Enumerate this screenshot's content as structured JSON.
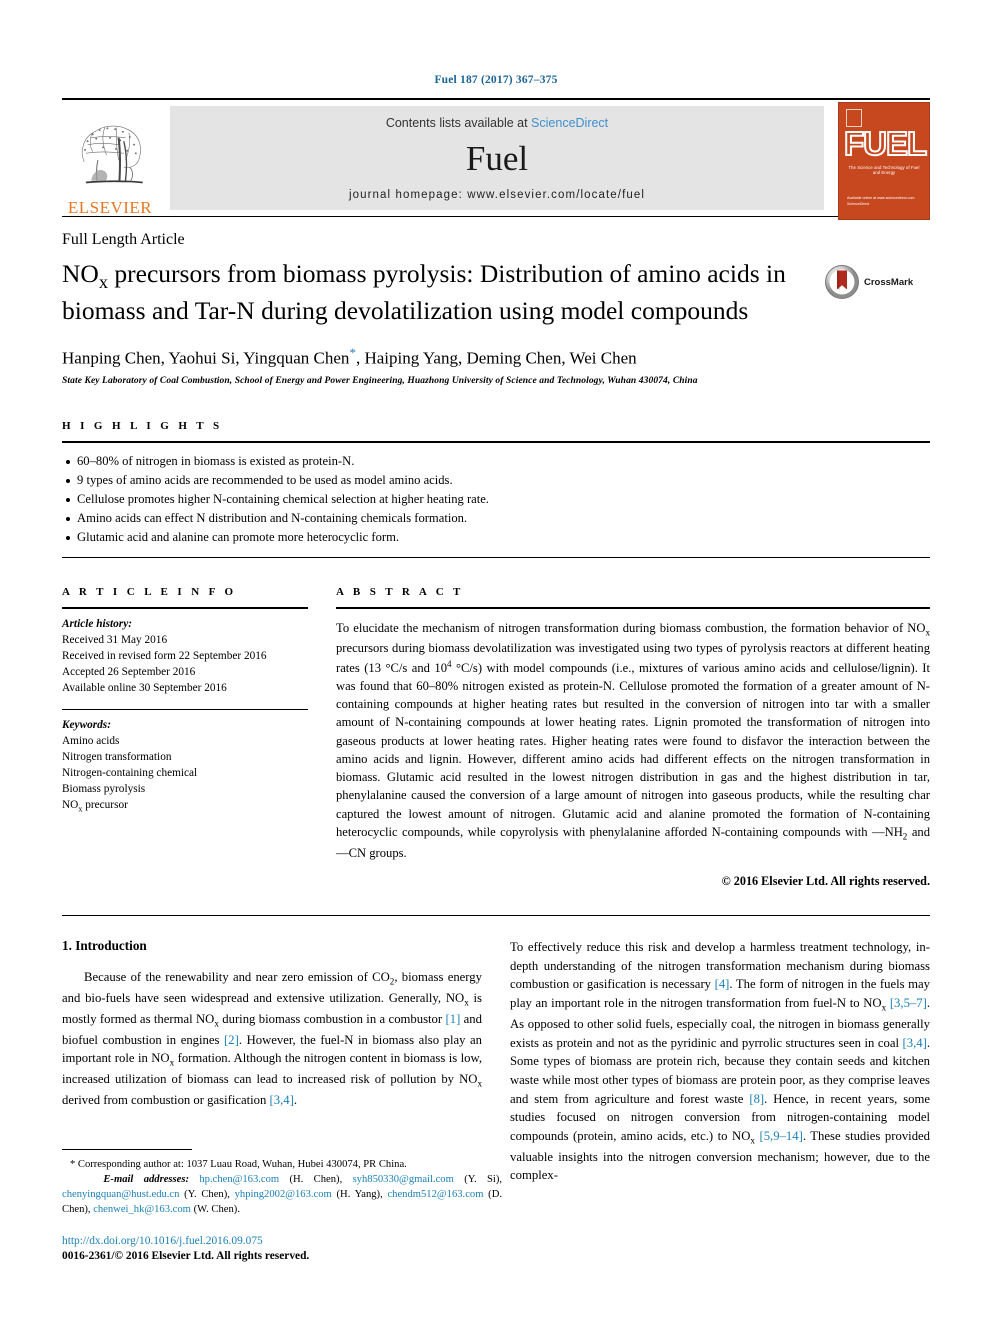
{
  "running_head": "Fuel 187 (2017) 367–375",
  "masthead": {
    "publisher": "ELSEVIER",
    "contents_prefix": "Contents lists available at ",
    "contents_link": "ScienceDirect",
    "journal_title": "Fuel",
    "homepage": "journal homepage: www.elsevier.com/locate/fuel",
    "cover": {
      "wordmark": "FUEL",
      "subtitle": "The Science and Technology of Fuel and Energy",
      "footer": "Available online at www.sciencedirect.com\nScienceDirect"
    }
  },
  "article": {
    "type": "Full Length Article",
    "title": "NOx precursors from biomass pyrolysis: Distribution of amino acids in biomass and Tar-N during devolatilization using model compounds",
    "authors": "Hanping Chen, Yaohui Si, Yingquan Chen",
    "authors_tail": ", Haiping Yang, Deming Chen, Wei Chen",
    "corresponding_marker": "*",
    "affiliation": "State Key Laboratory of Coal Combustion, School of Energy and Power Engineering, Huazhong University of Science and Technology, Wuhan 430074, China",
    "crossmark_label": "CrossMark"
  },
  "highlights": {
    "label": "H I G H L I G H T S",
    "items": [
      "60–80% of nitrogen in biomass is existed as protein-N.",
      "9 types of amino acids are recommended to be used as model amino acids.",
      "Cellulose promotes higher N-containing chemical selection at higher heating rate.",
      "Amino acids can effect N distribution and N-containing chemicals formation.",
      "Glutamic acid and alanine can promote more heterocyclic form."
    ]
  },
  "article_info": {
    "label": "A R T I C L E  I N F O",
    "history_head": "Article history:",
    "history": [
      "Received 31 May 2016",
      "Received in revised form 22 September 2016",
      "Accepted 26 September 2016",
      "Available online 30 September 2016"
    ],
    "keywords_head": "Keywords:",
    "keywords": [
      "Amino acids",
      "Nitrogen transformation",
      "Nitrogen-containing chemical",
      "Biomass pyrolysis",
      "NOx precursor"
    ]
  },
  "abstract": {
    "label": "A B S T R A C T",
    "text": "To elucidate the mechanism of nitrogen transformation during biomass combustion, the formation behavior of NOx precursors during biomass devolatilization was investigated using two types of pyrolysis reactors at different heating rates (13 °C/s and 10⁴ °C/s) with model compounds (i.e., mixtures of various amino acids and cellulose/lignin). It was found that 60–80% nitrogen existed as protein-N. Cellulose promoted the formation of a greater amount of N-containing compounds at higher heating rates but resulted in the conversion of nitrogen into tar with a smaller amount of N-containing compounds at lower heating rates. Lignin promoted the transformation of nitrogen into gaseous products at lower heating rates. Higher heating rates were found to disfavor the interaction between the amino acids and lignin. However, different amino acids had different effects on the nitrogen transformation in biomass. Glutamic acid resulted in the lowest nitrogen distribution in gas and the highest distribution in tar, phenylalanine caused the conversion of a large amount of nitrogen into gaseous products, while the resulting char captured the lowest amount of nitrogen. Glutamic acid and alanine promoted the formation of N-containing heterocyclic compounds, while copyrolysis with phenylalanine afforded N-containing compounds with —NH2 and —CN groups.",
    "copyright": "© 2016 Elsevier Ltd. All rights reserved."
  },
  "introduction": {
    "heading": "1. Introduction",
    "left_paragraph": "Because of the renewability and near zero emission of CO2, biomass energy and bio-fuels have seen widespread and extensive utilization. Generally, NOx is mostly formed as thermal NOx during biomass combustion in a combustor [1] and biofuel combustion in engines [2]. However, the fuel-N in biomass also play an important role in NOx formation. Although the nitrogen content in biomass is low, increased utilization of biomass can lead to increased risk of pollution by NOx derived from combustion or gasification [3,4].",
    "right_paragraph": "To effectively reduce this risk and develop a harmless treatment technology, in-depth understanding of the nitrogen transformation mechanism during biomass combustion or gasification is necessary [4]. The form of nitrogen in the fuels may play an important role in the nitrogen transformation from fuel-N to NOx [3,5–7]. As opposed to other solid fuels, especially coal, the nitrogen in biomass generally exists as protein and not as the pyridinic and pyrrolic structures seen in coal [3,4]. Some types of biomass are protein rich, because they contain seeds and kitchen waste while most other types of biomass are protein poor, as they comprise leaves and stem from agriculture and forest waste [8]. Hence, in recent years, some studies focused on nitrogen conversion from nitrogen-containing model compounds (protein, amino acids, etc.) to NOx [5,9–14]. These studies provided valuable insights into the nitrogen conversion mechanism; however, due to the complex-"
  },
  "footnote": {
    "corresponding": "Corresponding author at: 1037 Luau Road, Wuhan, Hubei 430074, PR China.",
    "email_label": "E-mail addresses:",
    "emails": [
      {
        "address": "hp.chen@163.com",
        "person": "(H. Chen)"
      },
      {
        "address": "syh850330@gmail.com",
        "person": "(Y. Si)"
      },
      {
        "address": "chenyingquan@hust.edu.cn",
        "person": "(Y. Chen)"
      },
      {
        "address": "yhping2002@163.com",
        "person": "(H. Yang)"
      },
      {
        "address": "chendm512@163.com",
        "person": "(D. Chen)"
      },
      {
        "address": "chenwei_hk@163.com",
        "person": "(W. Chen)"
      }
    ],
    "doi": "http://dx.doi.org/10.1016/j.fuel.2016.09.075",
    "issn_line": "0016-2361/© 2016 Elsevier Ltd. All rights reserved."
  },
  "colors": {
    "link": "#1a7fb5",
    "elsevier_orange": "#E77724",
    "cover_red": "#c7471f",
    "masthead_grey": "#e4e4e4"
  }
}
